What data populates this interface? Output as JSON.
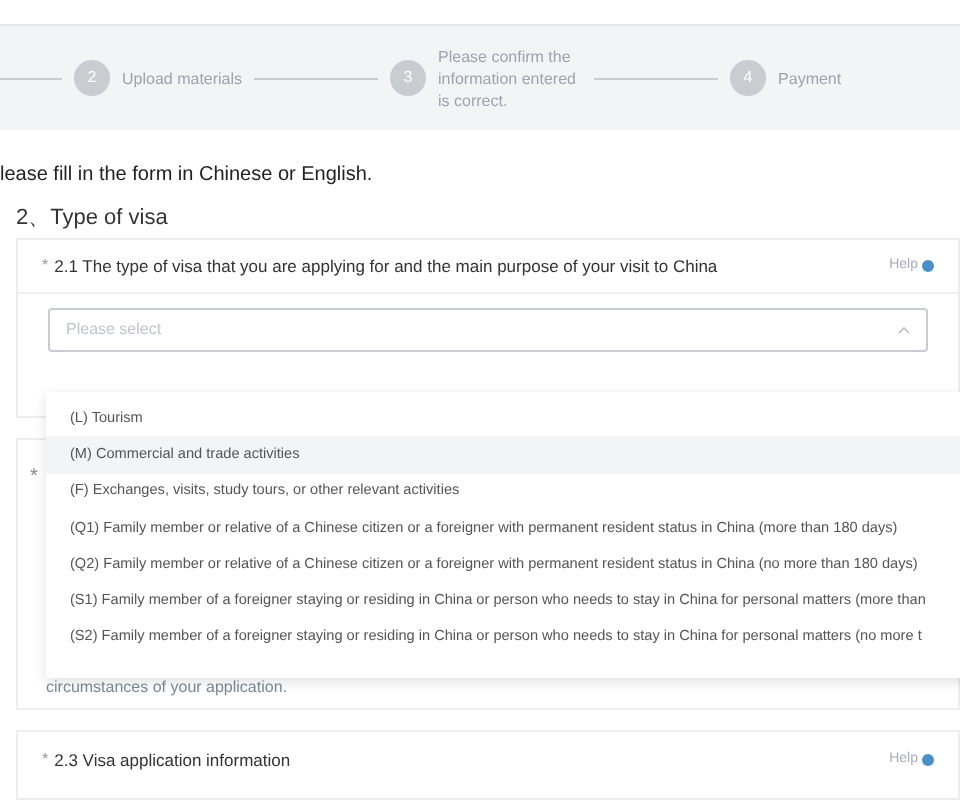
{
  "steps": [
    {
      "number": "2",
      "label": "Upload materials"
    },
    {
      "number": "3",
      "label": "Please confirm the information entered is correct."
    },
    {
      "number": "4",
      "label": "Payment"
    }
  ],
  "instruction": "lease fill in the form in Chinese or English.",
  "section_title": "2、Type of visa",
  "question_2_1": {
    "required_mark": "*",
    "label": "2.1 The type of visa that you are applying for and the main purpose of your visit to China",
    "help": "Help",
    "select": {
      "placeholder": "Please select",
      "expanded": true
    },
    "options": [
      {
        "label": "(L) Tourism",
        "hovered": false
      },
      {
        "label": "(M) Commercial and trade activities",
        "hovered": true
      },
      {
        "label": "(F) Exchanges, visits, study tours, or other relevant activities",
        "hovered": false
      },
      {
        "label": "(Q1) Family member or relative of a Chinese citizen or a foreigner with permanent resident status in China (more than 180 days)",
        "hovered": false
      },
      {
        "label": "(Q2) Family member or relative of a Chinese citizen or a foreigner with permanent resident status in China (no more than 180 days)",
        "hovered": false
      },
      {
        "label": "(S1) Family member of a foreigner staying or residing in China or person who needs to stay in China for personal matters (more than",
        "hovered": false
      },
      {
        "label": "(S2) Family member of a foreigner staying or residing in China or person who needs to stay in China for personal matters (no more t",
        "hovered": false
      }
    ]
  },
  "question_2_2": {
    "required_mark": "*",
    "note": "circumstances of your application."
  },
  "question_2_3": {
    "required_mark": "*",
    "label": "2.3 Visa application information",
    "help": "Help"
  }
}
